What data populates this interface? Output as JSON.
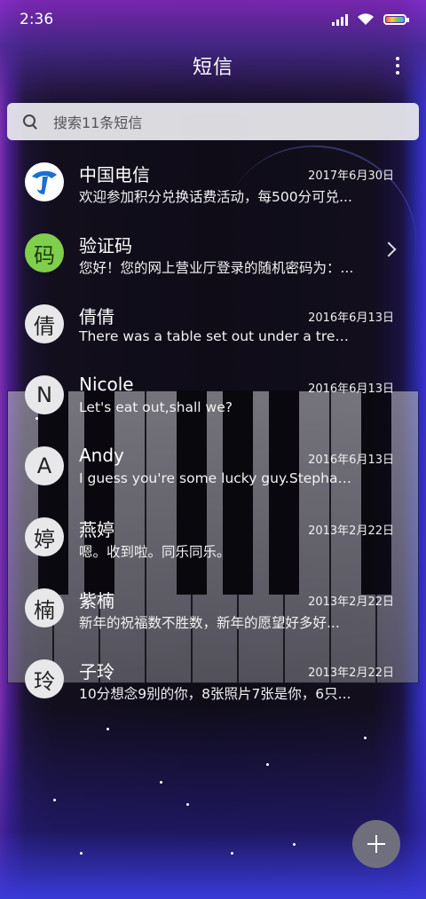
{
  "status_bar": {
    "time": "2:36"
  },
  "header": {
    "title": "短信",
    "more_icon": "more-vertical-icon"
  },
  "search": {
    "placeholder": "搜索11条短信",
    "icon": "search-icon"
  },
  "conversations": [
    {
      "avatar": "telecom-logo",
      "name": "中国电信",
      "date": "2017年6月30日",
      "preview": "欢迎参加积分兑换话费活动，每500分可兑..."
    },
    {
      "avatar": "码",
      "name": "验证码",
      "date": "",
      "preview": "您好！您的网上营业厅登录的随机密码为：..."
    },
    {
      "avatar": "倩",
      "name": "倩倩",
      "date": "2016年6月13日",
      "preview": "There was a table set out under a tree in..."
    },
    {
      "avatar": "N",
      "name": "Nicole",
      "date": "2016年6月13日",
      "preview": "Let's eat out,shall we?"
    },
    {
      "avatar": "A",
      "name": "Andy",
      "date": "2016年6月13日",
      "preview": "I guess you're some lucky guy.Stephani..."
    },
    {
      "avatar": "婷",
      "name": "燕婷",
      "date": "2013年2月22日",
      "preview": "嗯。收到啦。同乐同乐。"
    },
    {
      "avatar": "楠",
      "name": "紫楠",
      "date": "2013年2月22日",
      "preview": "新年的祝福数不胜数，新年的愿望好多好..."
    },
    {
      "avatar": "玲",
      "name": "子玲",
      "date": "2013年2月22日",
      "preview": "10分想念9别的你，8张照片7张是你，6只..."
    }
  ],
  "fab": {
    "icon": "plus-icon"
  },
  "colors": {
    "verification_avatar": "#7fcf4c",
    "accent_purple": "#8a2bc8",
    "accent_blue": "#3a3ad8"
  }
}
